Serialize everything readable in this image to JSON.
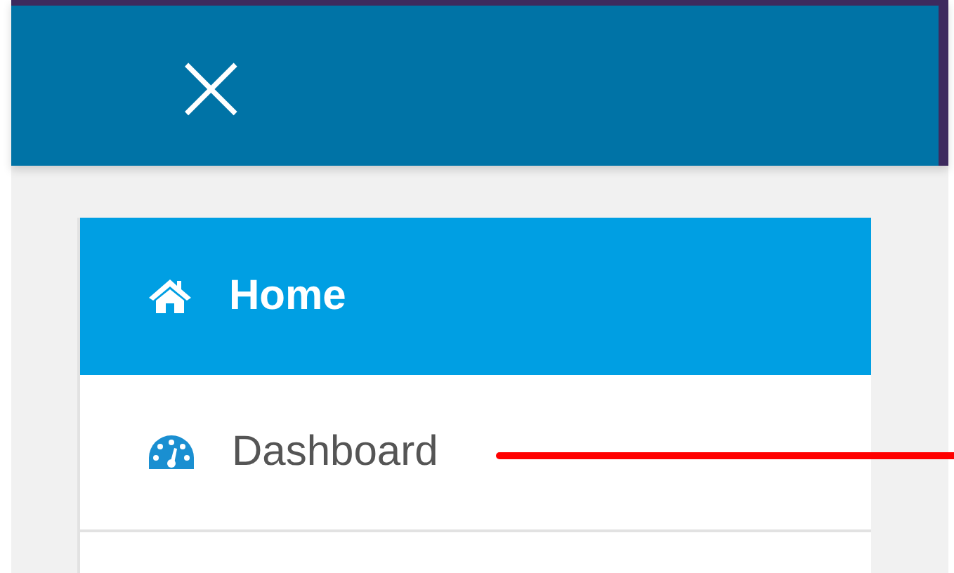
{
  "header": {
    "close_icon": "×"
  },
  "menu": {
    "items": [
      {
        "kind": "home",
        "label": "Home",
        "selected": true
      },
      {
        "kind": "dashboard",
        "label": "Dashboard",
        "selected": false
      }
    ]
  },
  "annotation": {
    "kind": "pointer-line"
  }
}
